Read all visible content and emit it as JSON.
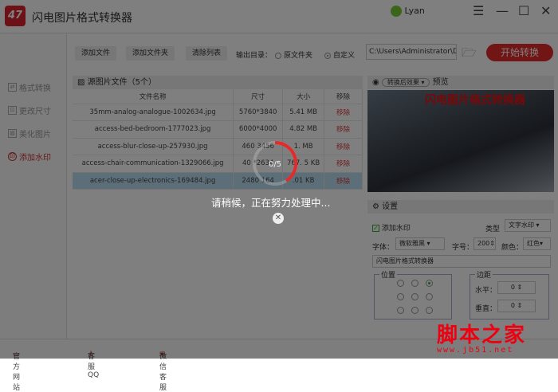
{
  "app": {
    "logo": "47",
    "title": "闪电图片格式转换器",
    "user": "Lyan",
    "menu_icon": "☰",
    "min_icon": "—",
    "max_icon": "☐",
    "close_icon": "✕"
  },
  "sidebar": {
    "items": [
      {
        "label": "格式转换",
        "icon": "⇄"
      },
      {
        "label": "更改尺寸",
        "icon": "⊡"
      },
      {
        "label": "美化图片",
        "icon": "▨"
      },
      {
        "label": "添加水印",
        "icon": "印",
        "active": true
      }
    ]
  },
  "toolbar": {
    "add_file": "添加文件",
    "add_folder": "添加文件夹",
    "clear_list": "清除列表",
    "output_label": "输出目录：",
    "opt_source": "原文件夹",
    "opt_custom": "自定义",
    "path": "C:\\Users\\Administrator\\De",
    "start": "开始转换"
  },
  "files": {
    "title": "源图片文件（5个）",
    "headers": [
      "文件名称",
      "尺寸",
      "大小",
      "移除"
    ],
    "rows": [
      {
        "name": "35mm-analog-analogue-1002634.jpg",
        "size": "5760*3840",
        "filesize": "5.41 MB",
        "remove": "移除"
      },
      {
        "name": "access-bed-bedroom-1777023.jpg",
        "size": "6000*4000",
        "filesize": "4.82 MB",
        "remove": "移除"
      },
      {
        "name": "access-blur-close-up-257930.jpg",
        "size": "460  3456",
        "filesize": "1.   MB",
        "remove": "移除"
      },
      {
        "name": "access-chair-communication-1329066.jpg",
        "size": "40  *2634",
        "filesize": "767.  5 KB",
        "remove": "移除"
      },
      {
        "name": "acer-close-up-electronics-169484.jpg",
        "size": "2480  164",
        "filesize": "  .01 KB",
        "remove": "移除"
      }
    ]
  },
  "preview": {
    "mode": "转换后效果",
    "label": "预览",
    "watermark": "闪电图片格式转换器"
  },
  "settings": {
    "title": "设置",
    "add_watermark": "添加水印",
    "type_label": "类型",
    "type_value": "文字水印",
    "font_label": "字体：",
    "font_value": "微软雅黑",
    "size_label": "字号：",
    "size_value": "200",
    "color_label": "颜色：",
    "color_value": "红色",
    "text": "闪电图片格式转换器",
    "position_label": "位置",
    "margin_label": "边距",
    "h_label": "水平：",
    "h_value": "0",
    "v_label": "垂直：",
    "v_value": "0"
  },
  "footer": {
    "website": "官方网站",
    "qq": "客服QQ",
    "wechat": "微信客服"
  },
  "progress": {
    "text": "0/5",
    "done": 0,
    "total": 5,
    "message": "请稍候，正在努力处理中...",
    "close": "✕"
  },
  "site_watermark": {
    "name": "脚本之家",
    "url": "www.jb51.net"
  },
  "colors": {
    "accent": "#e52a2a"
  }
}
